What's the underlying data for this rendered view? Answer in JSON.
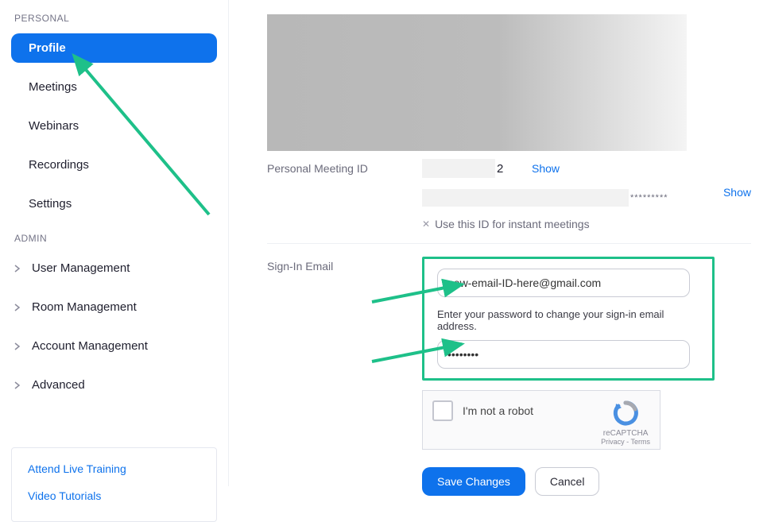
{
  "sidebar": {
    "personal_header": "PERSONAL",
    "items": [
      "Profile",
      "Meetings",
      "Webinars",
      "Recordings",
      "Settings"
    ],
    "admin_header": "ADMIN",
    "admin_items": [
      "User Management",
      "Room Management",
      "Account Management",
      "Advanced"
    ],
    "help": [
      "Attend Live Training",
      "Video Tutorials"
    ]
  },
  "main": {
    "pmi_label": "Personal Meeting ID",
    "pmi_partial": "2",
    "show": "Show",
    "stars": "*********",
    "show2": "Show",
    "instant_hint": "Use this ID for instant meetings",
    "signin_label": "Sign-In Email",
    "email_value": "new-email-ID-here@gmail.com",
    "pw_hint": "Enter your password to change your sign-in email address.",
    "pw_value": "••••••••",
    "recaptcha_text": "I'm not a robot",
    "recaptcha_brand": "reCAPTCHA",
    "recaptcha_small": "Privacy - Terms",
    "save": "Save Changes",
    "cancel": "Cancel"
  }
}
